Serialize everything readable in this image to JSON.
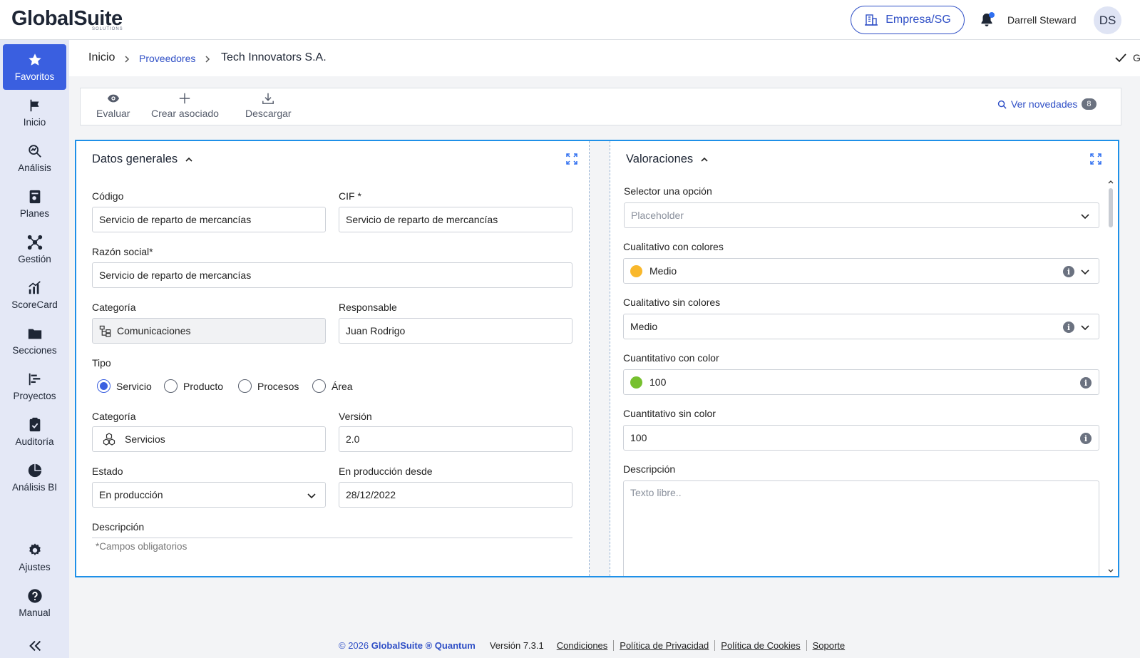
{
  "app": {
    "logo": "GlobalSuite",
    "logo_sub": "SOLUTIONS",
    "company": "Empresa/SG",
    "user_name": "Darrell Steward",
    "user_initials": "DS",
    "accent": "#3a5fe0"
  },
  "sidebar": {
    "items": [
      {
        "label": "Favoritos",
        "icon": "star-icon"
      },
      {
        "label": "Inicio",
        "icon": "flag-icon"
      },
      {
        "label": "Análisis",
        "icon": "analysis-icon"
      },
      {
        "label": "Planes",
        "icon": "plans-icon"
      },
      {
        "label": "Gestión",
        "icon": "network-icon"
      },
      {
        "label": "ScoreCard",
        "icon": "chart-icon"
      },
      {
        "label": "Secciones",
        "icon": "folder-icon"
      },
      {
        "label": "Proyectos",
        "icon": "gantt-icon"
      },
      {
        "label": "Auditoría",
        "icon": "clipboard-icon"
      },
      {
        "label": "Análisis BI",
        "icon": "pie-icon"
      },
      {
        "label": "Ajustes",
        "icon": "gear-icon"
      },
      {
        "label": "Manual",
        "icon": "help-icon"
      }
    ]
  },
  "breadcrumb": {
    "home": "Inicio",
    "section": "Proveedores",
    "current": "Tech Innovators S.A.",
    "saved": "Guardado"
  },
  "toolbar": {
    "evaluate": "Evaluar",
    "create": "Crear asociado",
    "download": "Descargar",
    "news": "Ver novedades",
    "news_count": "8"
  },
  "general": {
    "title": "Datos generales",
    "codigo_label": "Código",
    "codigo_value": "Servicio de reparto de mercancías",
    "cif_label": "CIF *",
    "cif_value": "Servicio de reparto de mercancías",
    "razon_label": "Razón social*",
    "razon_value": "Servicio de reparto de mercancías",
    "categoria_label": "Categoría",
    "categoria_value": "Comunicaciones",
    "responsable_label": "Responsable",
    "responsable_value": "Juan Rodrigo",
    "tipo_label": "Tipo",
    "tipo_options": [
      "Servicio",
      "Producto",
      "Procesos",
      "Área"
    ],
    "tipo_selected": "Servicio",
    "categoria2_label": "Categoría",
    "categoria2_value": "Servicios",
    "version_label": "Versión",
    "version_value": "2.0",
    "estado_label": "Estado",
    "estado_value": "En producción",
    "desde_label": "En producción desde",
    "desde_value": "28/12/2022",
    "descripcion_label": "Descripción",
    "required_note": "*Campos obligatorios"
  },
  "valoraciones": {
    "title": "Valoraciones",
    "selector_label": "Selector una opción",
    "selector_placeholder": "Placeholder",
    "cual_color_label": "Cualitativo con colores",
    "cual_color_value": "Medio",
    "cual_color_dot": "#f9b82c",
    "cual_label": "Cualitativo sin colores",
    "cual_value": "Medio",
    "cuant_color_label": "Cuantitativo con color",
    "cuant_color_value": "100",
    "cuant_color_dot": "#76c02e",
    "cuant_label": "Cuantitativo sin color",
    "cuant_value": "100",
    "desc_label": "Descripción",
    "desc_placeholder": "Texto libre.."
  },
  "footer": {
    "copyright": "© 2026",
    "brand": "GlobalSuite ® Quantum",
    "version": "Versión 7.3.1",
    "links": [
      "Condiciones",
      "Política de Privacidad",
      "Política de Cookies",
      "Soporte"
    ]
  }
}
